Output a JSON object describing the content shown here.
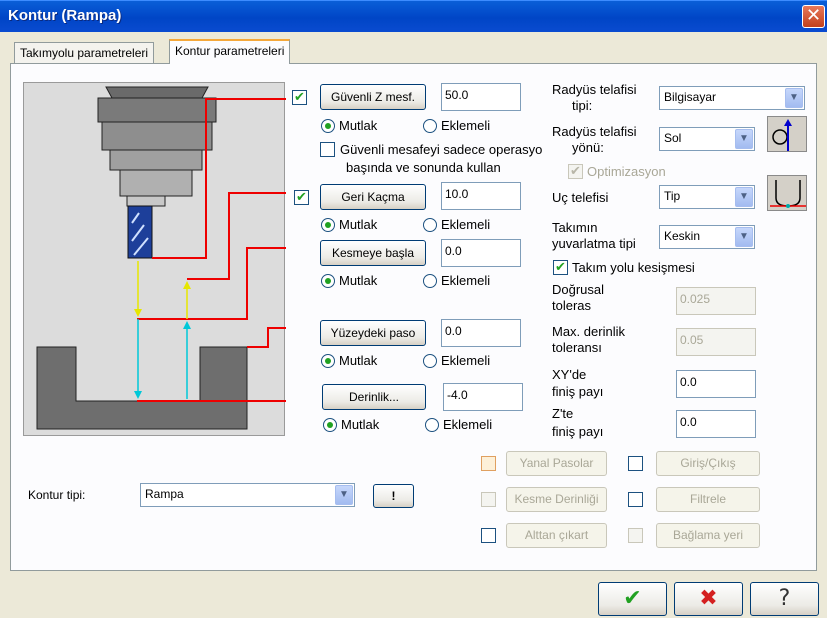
{
  "window": {
    "title": "Kontur (Rampa)",
    "close_glyph": "✕"
  },
  "tabs": [
    {
      "label": "Takımyolu parametreleri"
    },
    {
      "label": "Kontur parametreleri"
    }
  ],
  "left": {
    "safe_z": {
      "checked": true,
      "button": "Güvenli Z mesf.",
      "value": "50.0",
      "radio_abs": "Mutlak",
      "radio_inc": "Eklemeli",
      "selected": "Mutlak"
    },
    "safe_only": {
      "checked": false,
      "label_line1": "Güvenli mesafeyi sadece operasyo",
      "label_line2": "başında ve sonunda kullan"
    },
    "retract": {
      "checked": true,
      "button": "Geri Kaçma",
      "value": "10.0",
      "radio_abs": "Mutlak",
      "radio_inc": "Eklemeli",
      "selected": "Mutlak"
    },
    "feed_plane": {
      "button": "Kesmeye başla",
      "value": "0.0",
      "radio_abs": "Mutlak",
      "radio_inc": "Eklemeli",
      "selected": "Mutlak"
    },
    "top_stock": {
      "button": "Yüzeydeki paso",
      "value": "0.0",
      "radio_abs": "Mutlak",
      "radio_inc": "Eklemeli",
      "selected": "Mutlak"
    },
    "depth": {
      "button": "Derinlik...",
      "value": "-4.0",
      "radio_abs": "Mutlak",
      "radio_inc": "Eklemeli",
      "selected": "Mutlak"
    }
  },
  "right": {
    "comp_type": {
      "label_line1": "Radyüs telafisi",
      "label_line2": "tipi:",
      "value": "Bilgisayar"
    },
    "comp_dir": {
      "label_line1": "Radyüs telafisi",
      "label_line2": "yönü:",
      "value": "Sol"
    },
    "optimize": {
      "checked": true,
      "label": "Optimizasyon",
      "disabled": true
    },
    "tip_comp": {
      "label": "Uç telefisi",
      "value": "Tip"
    },
    "roll_cutter": {
      "label_line1": "Takımın",
      "label_line2": "yuvarlatma tipi",
      "value": "Keskin"
    },
    "infinite_look": {
      "checked": true,
      "label": "Takım yolu kesişmesi"
    },
    "linear_tol": {
      "label_line1": "Doğrusal",
      "label_line2": "toleras",
      "value": "0.025",
      "disabled": true
    },
    "max_depth_tol": {
      "label_line1": "Max. derinlik",
      "label_line2": "toleransı",
      "value": "0.05",
      "disabled": true
    },
    "xy_stock": {
      "label_line1": "XY'de",
      "label_line2": "finiş payı",
      "value": "0.0"
    },
    "z_stock": {
      "label_line1": "Z'te",
      "label_line2": "finiş payı",
      "value": "0.0"
    }
  },
  "bottom": {
    "contour_type_label": "Kontur tipi:",
    "contour_type_value": "Rampa",
    "help_glyph": "!",
    "options": [
      {
        "label": "Yanal Pasolar",
        "checked": false
      },
      {
        "label": "Giriş/Çıkış",
        "checked": false
      },
      {
        "label": "Kesme Derinliği",
        "checked": false
      },
      {
        "label": "Filtrele",
        "checked": false
      },
      {
        "label": "Alttan çıkart",
        "checked": false
      },
      {
        "label": "Bağlama yeri",
        "checked": false
      }
    ]
  },
  "dialog_buttons": {
    "ok_glyph": "✔",
    "cancel_glyph": "✖",
    "help_glyph": "?"
  },
  "colors": {
    "ok": "#21a121",
    "cancel": "#d42020",
    "accent": "#0a5fd8"
  }
}
